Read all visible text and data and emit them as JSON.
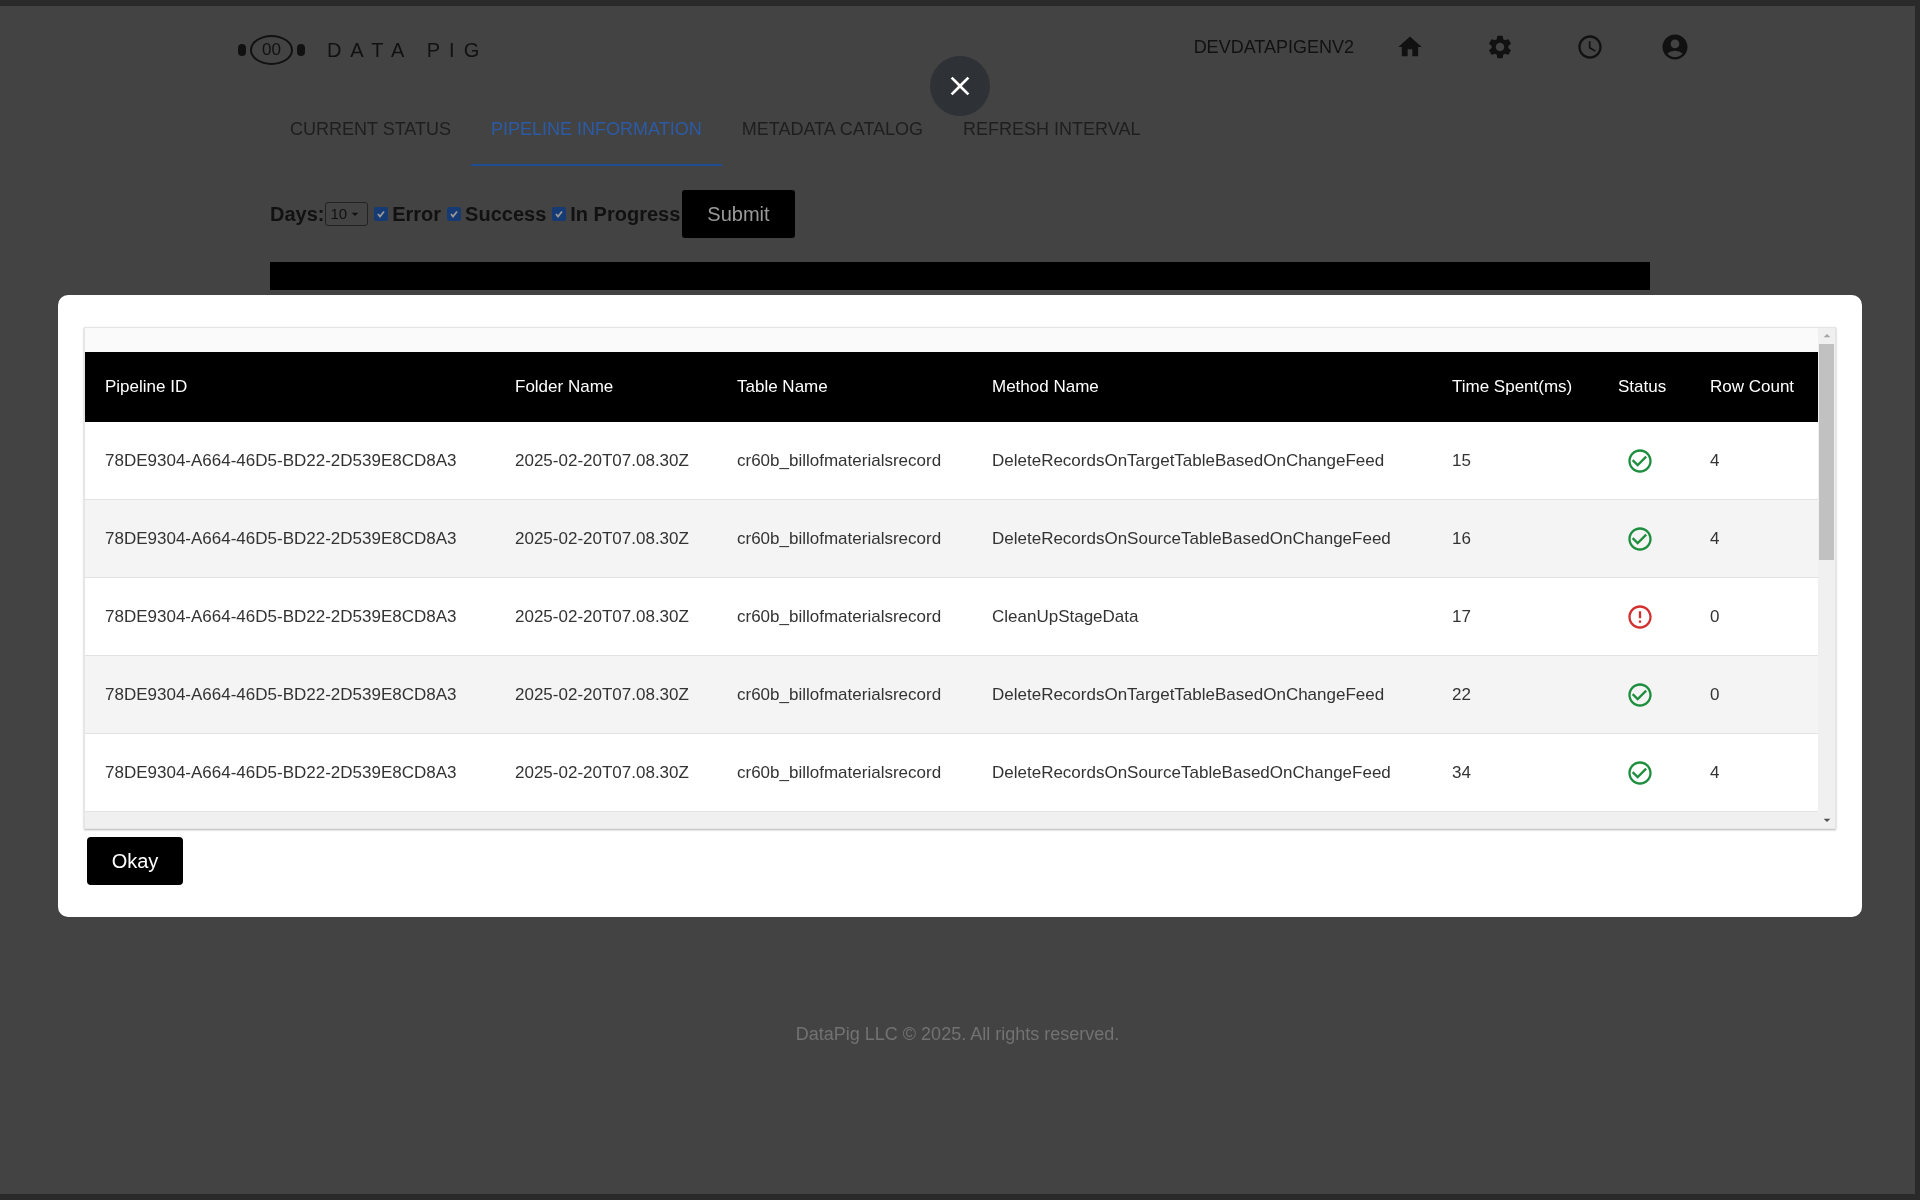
{
  "header": {
    "logo_mark": "00",
    "logo_text": "DATA PIG",
    "environment": "DEVDATAPIGENV2"
  },
  "tabs": [
    {
      "label": "CURRENT STATUS",
      "selected": false
    },
    {
      "label": "PIPELINE INFORMATION",
      "selected": true
    },
    {
      "label": "METADATA CATALOG",
      "selected": false
    },
    {
      "label": "REFRESH INTERVAL",
      "selected": false
    }
  ],
  "filters": {
    "days_label": "Days:",
    "days_value": "10",
    "options": [
      {
        "label": "Error",
        "checked": true
      },
      {
        "label": "Success",
        "checked": true
      },
      {
        "label": "In Progress",
        "checked": true
      }
    ],
    "submit": "Submit"
  },
  "modal": {
    "columns": [
      "Pipeline ID",
      "Folder Name",
      "Table Name",
      "Method Name",
      "Time Spent(ms)",
      "Status",
      "Row Count"
    ],
    "rows": [
      {
        "pipeline_id": "78DE9304-A664-46D5-BD22-2D539E8CD8A3",
        "folder": "2025-02-20T07.08.30Z",
        "table": "cr60b_billofmaterialsrecord",
        "method": "DeleteRecordsOnTargetTableBasedOnChangeFeed",
        "time": "15",
        "kind": "success",
        "row_count": "4"
      },
      {
        "pipeline_id": "78DE9304-A664-46D5-BD22-2D539E8CD8A3",
        "folder": "2025-02-20T07.08.30Z",
        "table": "cr60b_billofmaterialsrecord",
        "method": "DeleteRecordsOnSourceTableBasedOnChangeFeed",
        "time": "16",
        "kind": "success",
        "row_count": "4"
      },
      {
        "pipeline_id": "78DE9304-A664-46D5-BD22-2D539E8CD8A3",
        "folder": "2025-02-20T07.08.30Z",
        "table": "cr60b_billofmaterialsrecord",
        "method": "CleanUpStageData",
        "time": "17",
        "kind": "error",
        "row_count": "0"
      },
      {
        "pipeline_id": "78DE9304-A664-46D5-BD22-2D539E8CD8A3",
        "folder": "2025-02-20T07.08.30Z",
        "table": "cr60b_billofmaterialsrecord",
        "method": "DeleteRecordsOnTargetTableBasedOnChangeFeed",
        "time": "22",
        "kind": "success",
        "row_count": "0"
      },
      {
        "pipeline_id": "78DE9304-A664-46D5-BD22-2D539E8CD8A3",
        "folder": "2025-02-20T07.08.30Z",
        "table": "cr60b_billofmaterialsrecord",
        "method": "DeleteRecordsOnSourceTableBasedOnChangeFeed",
        "time": "34",
        "kind": "success",
        "row_count": "4"
      }
    ],
    "okay": "Okay"
  },
  "footer": "DataPig LLC © 2025. All rights reserved."
}
